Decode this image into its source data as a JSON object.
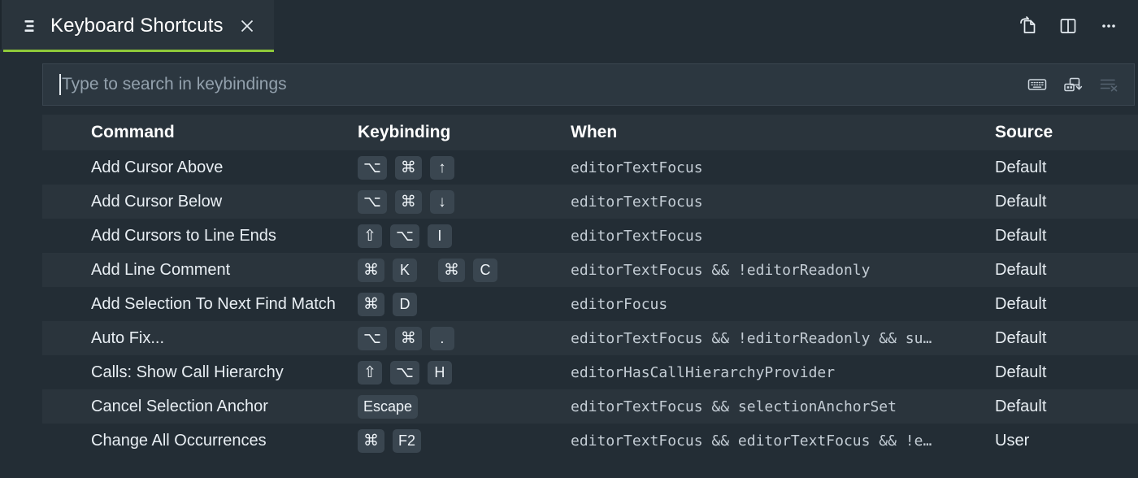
{
  "theme": {
    "background": "#232d35",
    "row_alt": "#2a343c",
    "accent": "#8fc93a",
    "key_chip": "#3a4650",
    "text": "#e8eef3",
    "muted": "#93a1ad"
  },
  "tab": {
    "title": "Keyboard Shortcuts",
    "icon": "list-icon",
    "close_icon": "close-icon",
    "active": true
  },
  "tabbar_actions": [
    {
      "name": "open-keyboard-shortcuts-file-icon",
      "label": "Open Keyboard Shortcuts (JSON)"
    },
    {
      "name": "split-editor-icon",
      "label": "Split Editor Right"
    },
    {
      "name": "more-actions-icon",
      "label": "More Actions..."
    }
  ],
  "search": {
    "value": "",
    "placeholder": "Type to search in keybindings",
    "actions": [
      {
        "name": "record-keys-icon",
        "label": "Record Keys"
      },
      {
        "name": "sort-by-precedence-icon",
        "label": "Sort by Precedence"
      },
      {
        "name": "clear-keybindings-search-input-icon",
        "label": "Clear Keybindings Search Input",
        "disabled": true
      }
    ]
  },
  "table": {
    "columns": [
      {
        "key": "command",
        "label": "Command"
      },
      {
        "key": "keybinding",
        "label": "Keybinding"
      },
      {
        "key": "when",
        "label": "When"
      },
      {
        "key": "source",
        "label": "Source"
      }
    ],
    "rows": [
      {
        "command": "Add Cursor Above",
        "chords": [
          [
            "⌥",
            "⌘",
            "↑"
          ]
        ],
        "when": "editorTextFocus",
        "source": "Default"
      },
      {
        "command": "Add Cursor Below",
        "chords": [
          [
            "⌥",
            "⌘",
            "↓"
          ]
        ],
        "when": "editorTextFocus",
        "source": "Default"
      },
      {
        "command": "Add Cursors to Line Ends",
        "chords": [
          [
            "⇧",
            "⌥",
            "I"
          ]
        ],
        "when": "editorTextFocus",
        "source": "Default"
      },
      {
        "command": "Add Line Comment",
        "chords": [
          [
            "⌘",
            "K"
          ],
          [
            "⌘",
            "C"
          ]
        ],
        "when": "editorTextFocus && !editorReadonly",
        "source": "Default"
      },
      {
        "command": "Add Selection To Next Find Match",
        "chords": [
          [
            "⌘",
            "D"
          ]
        ],
        "when": "editorFocus",
        "source": "Default"
      },
      {
        "command": "Auto Fix...",
        "chords": [
          [
            "⌥",
            "⌘",
            "."
          ]
        ],
        "when": "editorTextFocus && !editorReadonly && su…",
        "source": "Default"
      },
      {
        "command": "Calls: Show Call Hierarchy",
        "chords": [
          [
            "⇧",
            "⌥",
            "H"
          ]
        ],
        "when": "editorHasCallHierarchyProvider",
        "source": "Default"
      },
      {
        "command": "Cancel Selection Anchor",
        "chords": [
          [
            "Escape"
          ]
        ],
        "when": "editorTextFocus && selectionAnchorSet",
        "source": "Default"
      },
      {
        "command": "Change All Occurrences",
        "chords": [
          [
            "⌘",
            "F2"
          ]
        ],
        "when": "editorTextFocus && editorTextFocus && !e…",
        "source": "User"
      }
    ]
  }
}
